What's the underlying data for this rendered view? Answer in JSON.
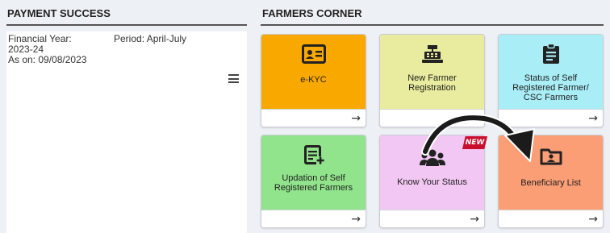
{
  "payment": {
    "title": "PAYMENT SUCCESS",
    "financial_year_label": "Financial Year:",
    "financial_year_value": "2023-24",
    "as_on": "As on: 09/08/2023",
    "period": "Period: April-July"
  },
  "farmers_corner": {
    "title": "FARMERS CORNER",
    "cards": [
      {
        "label": "e-KYC",
        "icon": "id-card-icon",
        "color": "#f9a800"
      },
      {
        "label": "New Farmer Registration",
        "icon": "cash-register-icon",
        "color": "#e9ec9e"
      },
      {
        "label": "Status of Self Registered Farmer/ CSC Farmers",
        "icon": "clipboard-icon",
        "color": "#a9eef7"
      },
      {
        "label": "Updation of Self Registered Farmers",
        "icon": "edit-document-icon",
        "color": "#91e48c"
      },
      {
        "label": "Know Your Status",
        "icon": "group-icon",
        "color": "#f2c7f3"
      },
      {
        "label": "Beneficiary List",
        "icon": "folder-user-icon",
        "color": "#fb9e76"
      }
    ],
    "new_badge": "NEW",
    "arrow_glyph": "→"
  }
}
